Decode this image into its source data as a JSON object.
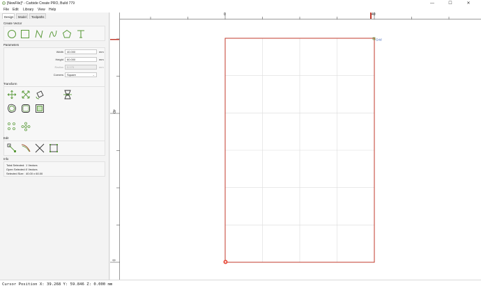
{
  "window": {
    "title": "[NewFile]* - Carbide Create PRO, Build 779",
    "minimize_glyph": "—",
    "maximize_glyph": "☐",
    "close_glyph": "✕"
  },
  "menu": [
    "File",
    "Edit",
    "Library",
    "View",
    "Help"
  ],
  "tabs": [
    "Design",
    "Model",
    "Toolpaths"
  ],
  "create_vector": {
    "title": "Create Vector",
    "tools": [
      "circle-icon",
      "rectangle-icon",
      "polyline-icon",
      "curve-icon",
      "polygon-icon",
      "text-icon"
    ]
  },
  "parameters": {
    "title": "Parameters",
    "width_label": "Width",
    "width_value": "40.000",
    "width_unit": "mm",
    "height_label": "Height",
    "height_value": "60.000",
    "height_unit": "mm",
    "radius_label": "Radius",
    "radius_value": "3.175",
    "radius_unit": "mm",
    "corners_label": "Corners",
    "corners_value": "Square"
  },
  "transform": {
    "title": "Transform",
    "tools": [
      "move-icon",
      "scale-icon",
      "rotate-icon",
      "mirror-icon",
      "offset-icon",
      "fillet-icon",
      "boolean-icon",
      "align-icon",
      "pattern-icon"
    ]
  },
  "edit": {
    "title": "Edit",
    "tools": [
      "node-edit-icon",
      "knife-icon",
      "trim-icon",
      "bounding-box-icon"
    ]
  },
  "info": {
    "title": "Info",
    "total_selected_label": "Total Selected:",
    "total_selected_value": "1 Vectors",
    "open_selected_label": "Open Selected:",
    "open_selected_value": "0 Vectors",
    "selected_size_label": "Selected Size:",
    "selected_size_value": "40.00 x 60.00"
  },
  "canvas": {
    "ruler_top_labels": [
      "0",
      "40"
    ],
    "ruler_left_labels": [
      "40",
      "0"
    ],
    "grid_label": "Grid",
    "stock_width": 40,
    "stock_height": 60,
    "grid_columns": 4,
    "grid_rows": 6,
    "accent_color": "#c0392b"
  },
  "status": {
    "text": "Cursor Position X: 39.268 Y: 59.846 Z: 0.000 mm"
  }
}
